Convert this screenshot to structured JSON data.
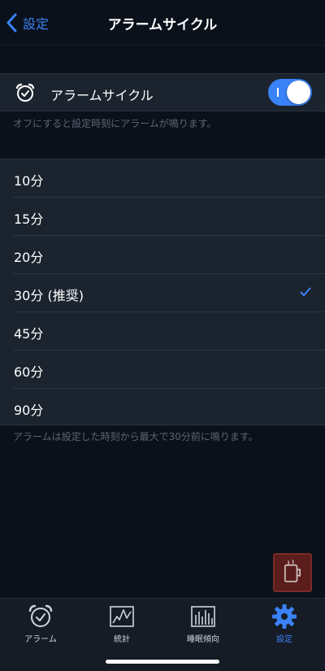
{
  "nav": {
    "back_label": "設定",
    "title": "アラームサイクル"
  },
  "alarm_cycle": {
    "label": "アラームサイクル",
    "enabled": true,
    "toggle_text": "I"
  },
  "footnote_top": "オフにすると設定時刻にアラームが鳴ります。",
  "options": [
    {
      "label": "10分",
      "selected": false
    },
    {
      "label": "15分",
      "selected": false
    },
    {
      "label": "20分",
      "selected": false
    },
    {
      "label": "30分 (推奨)",
      "selected": true
    },
    {
      "label": "45分",
      "selected": false
    },
    {
      "label": "60分",
      "selected": false
    },
    {
      "label": "90分",
      "selected": false
    }
  ],
  "footnote_bottom": "アラームは設定した時刻から最大で30分前に鳴ります。",
  "tabs": [
    {
      "label": "アラーム",
      "icon": "alarm-clock-icon",
      "active": false
    },
    {
      "label": "統計",
      "icon": "line-chart-icon",
      "active": false
    },
    {
      "label": "睡眠傾向",
      "icon": "bar-chart-icon",
      "active": false
    },
    {
      "label": "設定",
      "icon": "gear-icon",
      "active": true
    }
  ],
  "colors": {
    "accent": "#3a82f7",
    "background": "#0b111b",
    "cell": "#1b232e",
    "footnote": "#5c6572"
  }
}
